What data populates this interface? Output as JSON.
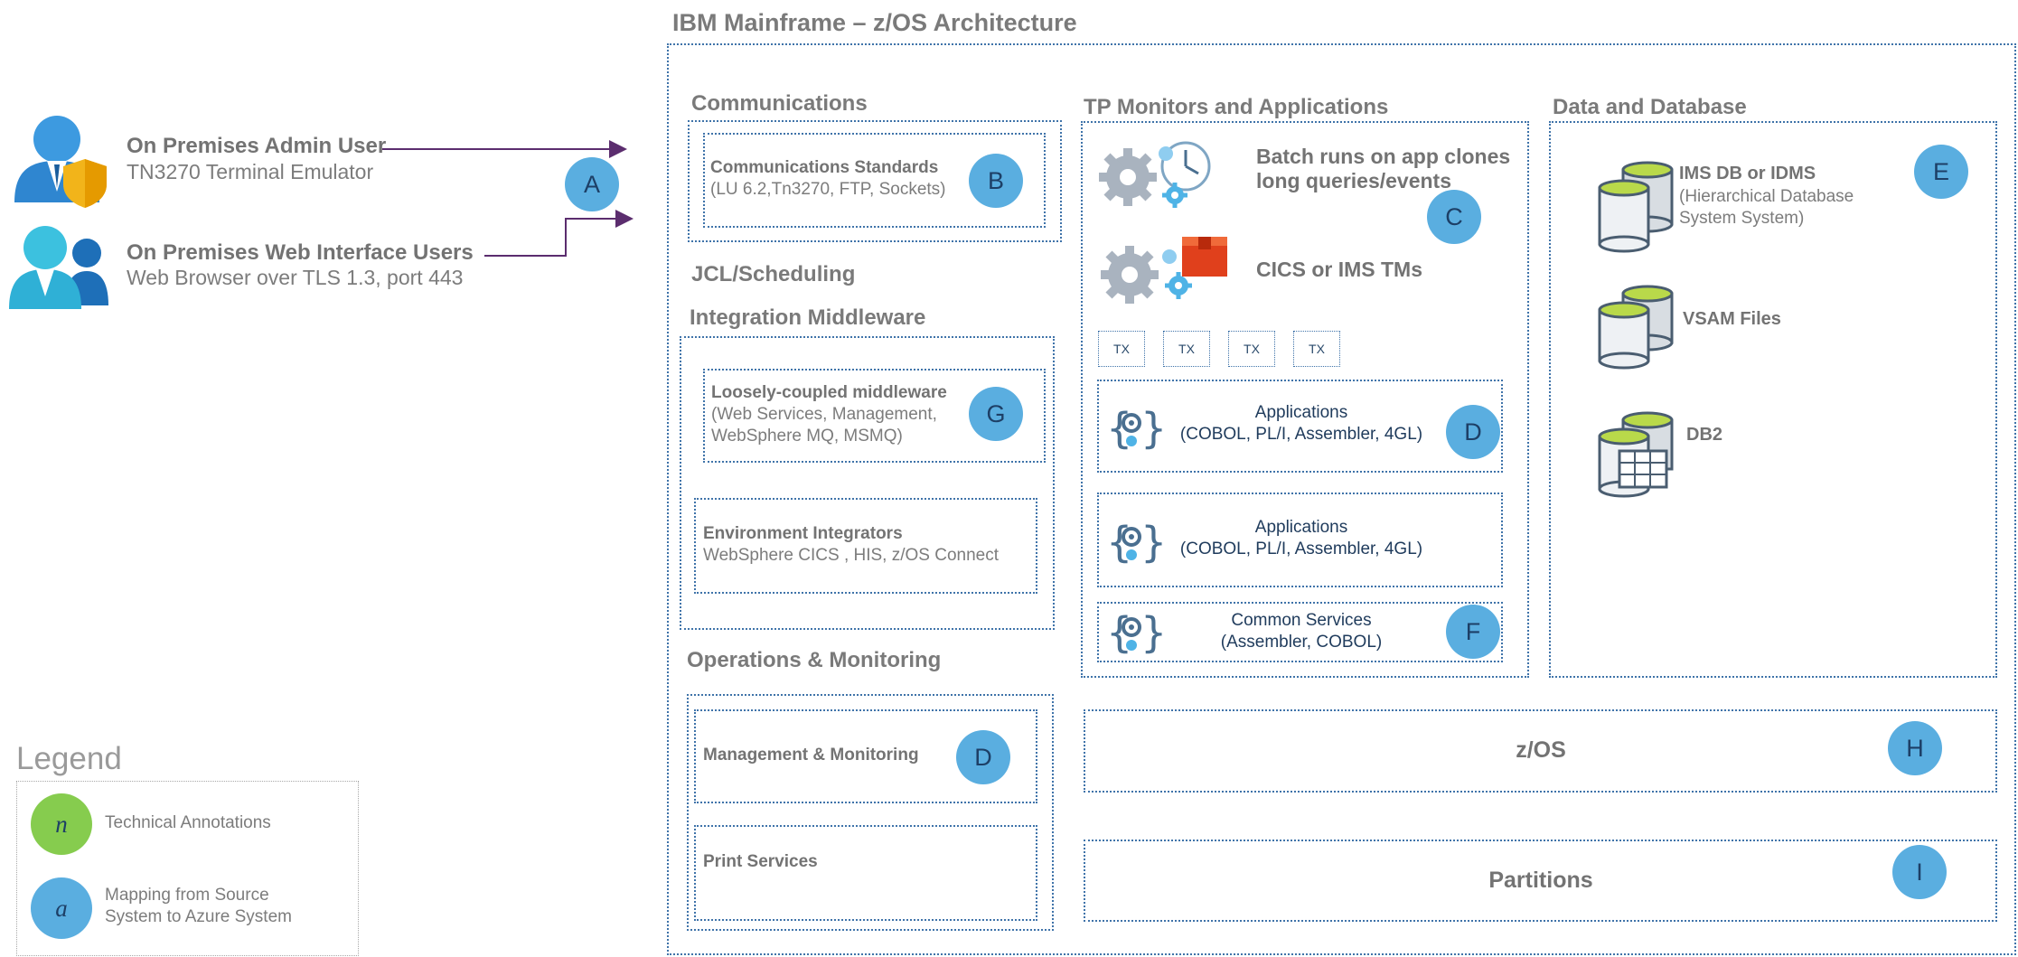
{
  "title": "IBM Mainframe – z/OS Architecture",
  "users": {
    "admin": {
      "name": "On Premises Admin User",
      "detail": "TN3270 Terminal Emulator"
    },
    "web": {
      "name": "On Premises Web Interface Users",
      "detail": "Web Browser over TLS 1.3, port 443"
    }
  },
  "badges": {
    "a": "A",
    "b": "B",
    "c": "C",
    "d_app": "D",
    "d_mgmt": "D",
    "e": "E",
    "f": "F",
    "g": "G",
    "h": "H",
    "i": "I"
  },
  "communications": {
    "title": "Communications",
    "standards_title": "Communications Standards",
    "standards_detail": "(LU 6.2,Tn3270, FTP, Sockets)"
  },
  "jcl": {
    "title": "JCL/Scheduling"
  },
  "integration": {
    "title": "Integration Middleware",
    "loose_title": "Loosely-coupled middleware",
    "loose_detail_1": "(Web Services, Management,",
    "loose_detail_2": "WebSphere MQ, MSMQ)",
    "env_title": "Environment Integrators",
    "env_detail": "WebSphere CICS , HIS, z/OS Connect"
  },
  "operations": {
    "title": "Operations & Monitoring",
    "mgmt": "Management & Monitoring",
    "print": "Print Services"
  },
  "tp": {
    "title": "TP Monitors and Applications",
    "batch_1": "Batch runs on app clones",
    "batch_2": "long queries/events",
    "cics": "CICS  or IMS TMs",
    "tx": [
      "TX",
      "TX",
      "TX",
      "TX"
    ],
    "app1_line1": "Applications",
    "app1_line2": "(COBOL, PL/I, Assembler, 4GL)",
    "app2_line1": "Applications",
    "app2_line2": "(COBOL, PL/I, Assembler, 4GL)",
    "common_line1": "Common Services",
    "common_line2": "(Assembler, COBOL)"
  },
  "data": {
    "title": "Data and Database",
    "ims_title": "IMS DB or IDMS",
    "ims_detail_1": "(Hierarchical Database",
    "ims_detail_2": "System System)",
    "vsam": "VSAM Files",
    "db2": "DB2"
  },
  "zos": {
    "label": "z/OS"
  },
  "partitions": {
    "label": "Partitions"
  },
  "legend": {
    "title": "Legend",
    "tech_symbol": "n",
    "tech_label": "Technical Annotations",
    "map_symbol": "a",
    "map_label_1": "Mapping from Source",
    "map_label_2": "System to Azure System"
  },
  "colors": {
    "badge_blue": "#5aaee0",
    "badge_green": "#86cc4e",
    "border_blue": "#3f73a9",
    "arrow": "#5b2d6e",
    "text_grey": "#737373",
    "gear_grey": "#a9b3bf",
    "gear_blue": "#4fb3e6",
    "cylinder_green": "#b9d94a"
  },
  "icons": [
    "admin-user-shield-icon",
    "web-users-icon",
    "batch-gears-clock-icon",
    "cics-gears-box-icon",
    "code-gear-icon",
    "database-cylinder-icon",
    "database-table-icon"
  ]
}
